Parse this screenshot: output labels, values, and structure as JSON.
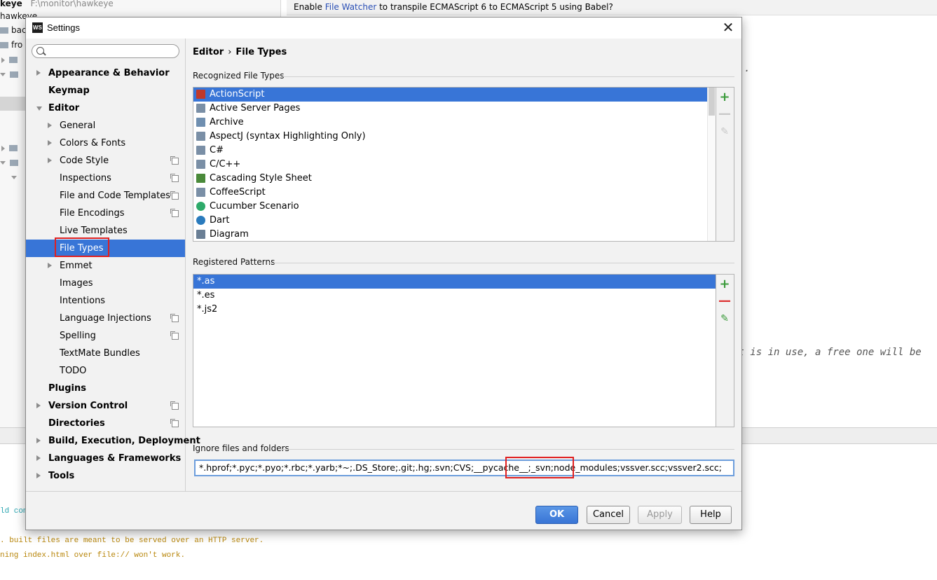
{
  "background": {
    "project_header": {
      "name": "keye",
      "path": "F:\\monitor\\hawkeye"
    },
    "project_rows": [
      "hawkeye",
      "bac",
      "fro"
    ],
    "banner": {
      "prefix": "Enable ",
      "link": "File Watcher",
      "suffix": " to transpile ECMAScript 6 to ECMAScript 5 using Babel?"
    },
    "code_line": "rt is in use, a free one will be",
    "code_dot": ".",
    "console_lines": [
      {
        "text": "ld com",
        "color": "#2aa5b0"
      },
      {
        "text": ". built files are meant to be served over an HTTP server.",
        "color": "#b8860b"
      },
      {
        "text": "ning index.html over file:// won't work.",
        "color": "#b8860b"
      }
    ]
  },
  "dialog": {
    "title": "Settings",
    "logo_text": "WS",
    "close_glyph": "✕",
    "search": {
      "value": "",
      "placeholder": ""
    },
    "tree": [
      {
        "label": "Appearance & Behavior",
        "level": 0,
        "bold": true,
        "arrow": "right",
        "proj": false
      },
      {
        "label": "Keymap",
        "level": 0,
        "bold": true,
        "arrow": "none",
        "proj": false
      },
      {
        "label": "Editor",
        "level": 0,
        "bold": true,
        "arrow": "down",
        "proj": false
      },
      {
        "label": "General",
        "level": 1,
        "bold": false,
        "arrow": "right",
        "proj": false
      },
      {
        "label": "Colors & Fonts",
        "level": 1,
        "bold": false,
        "arrow": "right",
        "proj": false
      },
      {
        "label": "Code Style",
        "level": 1,
        "bold": false,
        "arrow": "right",
        "proj": true
      },
      {
        "label": "Inspections",
        "level": 1,
        "bold": false,
        "arrow": "none",
        "proj": true
      },
      {
        "label": "File and Code Templates",
        "level": 1,
        "bold": false,
        "arrow": "none",
        "proj": true
      },
      {
        "label": "File Encodings",
        "level": 1,
        "bold": false,
        "arrow": "none",
        "proj": true
      },
      {
        "label": "Live Templates",
        "level": 1,
        "bold": false,
        "arrow": "none",
        "proj": false
      },
      {
        "label": "File Types",
        "level": 1,
        "bold": false,
        "arrow": "none",
        "proj": false,
        "selected": true
      },
      {
        "label": "Emmet",
        "level": 1,
        "bold": false,
        "arrow": "right",
        "proj": false
      },
      {
        "label": "Images",
        "level": 1,
        "bold": false,
        "arrow": "none",
        "proj": false
      },
      {
        "label": "Intentions",
        "level": 1,
        "bold": false,
        "arrow": "none",
        "proj": false
      },
      {
        "label": "Language Injections",
        "level": 1,
        "bold": false,
        "arrow": "none",
        "proj": true
      },
      {
        "label": "Spelling",
        "level": 1,
        "bold": false,
        "arrow": "none",
        "proj": true
      },
      {
        "label": "TextMate Bundles",
        "level": 1,
        "bold": false,
        "arrow": "none",
        "proj": false
      },
      {
        "label": "TODO",
        "level": 1,
        "bold": false,
        "arrow": "none",
        "proj": false
      },
      {
        "label": "Plugins",
        "level": 0,
        "bold": true,
        "arrow": "none",
        "proj": false
      },
      {
        "label": "Version Control",
        "level": 0,
        "bold": true,
        "arrow": "right",
        "proj": true
      },
      {
        "label": "Directories",
        "level": 0,
        "bold": true,
        "arrow": "none",
        "proj": true
      },
      {
        "label": "Build, Execution, Deployment",
        "level": 0,
        "bold": true,
        "arrow": "right",
        "proj": false
      },
      {
        "label": "Languages & Frameworks",
        "level": 0,
        "bold": true,
        "arrow": "right",
        "proj": false
      },
      {
        "label": "Tools",
        "level": 0,
        "bold": true,
        "arrow": "right",
        "proj": false
      }
    ],
    "breadcrumb": {
      "parent": "Editor",
      "separator": "›",
      "current": "File Types"
    },
    "recognized": {
      "label": "Recognized File Types",
      "items": [
        {
          "name": "ActionScript",
          "icon": "actionscript-icon",
          "color": "#c0392b",
          "selected": true
        },
        {
          "name": "Active Server Pages",
          "icon": "asp-icon",
          "color": "#7a8fa6"
        },
        {
          "name": "Archive",
          "icon": "archive-icon",
          "color": "#6f8fb0"
        },
        {
          "name": "AspectJ (syntax Highlighting Only)",
          "icon": "aspectj-icon",
          "color": "#7a8fa6"
        },
        {
          "name": "C#",
          "icon": "csharp-icon",
          "color": "#7a8fa6"
        },
        {
          "name": "C/C++",
          "icon": "cpp-icon",
          "color": "#7a8fa6"
        },
        {
          "name": "Cascading Style Sheet",
          "icon": "css-icon",
          "color": "#4a8a3a"
        },
        {
          "name": "CoffeeScript",
          "icon": "coffeescript-icon",
          "color": "#7a8fa6"
        },
        {
          "name": "Cucumber Scenario",
          "icon": "cucumber-icon",
          "color": "#2eaa6a"
        },
        {
          "name": "Dart",
          "icon": "dart-icon",
          "color": "#2a7bbd"
        },
        {
          "name": "Diagram",
          "icon": "diagram-icon",
          "color": "#6a7f95"
        }
      ]
    },
    "patterns": {
      "label": "Registered Patterns",
      "items": [
        {
          "name": "*.as",
          "selected": true
        },
        {
          "name": "*.es"
        },
        {
          "name": "*.js2"
        }
      ]
    },
    "tools": {
      "add": "+",
      "remove": "—",
      "edit": "✎"
    },
    "ignore": {
      "label": "Ignore files and folders",
      "value": "*.hprof;*.pyc;*.pyo;*.rbc;*.yarb;*~;.DS_Store;.git;.hg;.svn;CVS;__pycache__;_svn;node_modules;vssver.scc;vssver2.scc;"
    },
    "buttons": {
      "ok": "OK",
      "cancel": "Cancel",
      "apply": "Apply",
      "help": "Help"
    }
  }
}
